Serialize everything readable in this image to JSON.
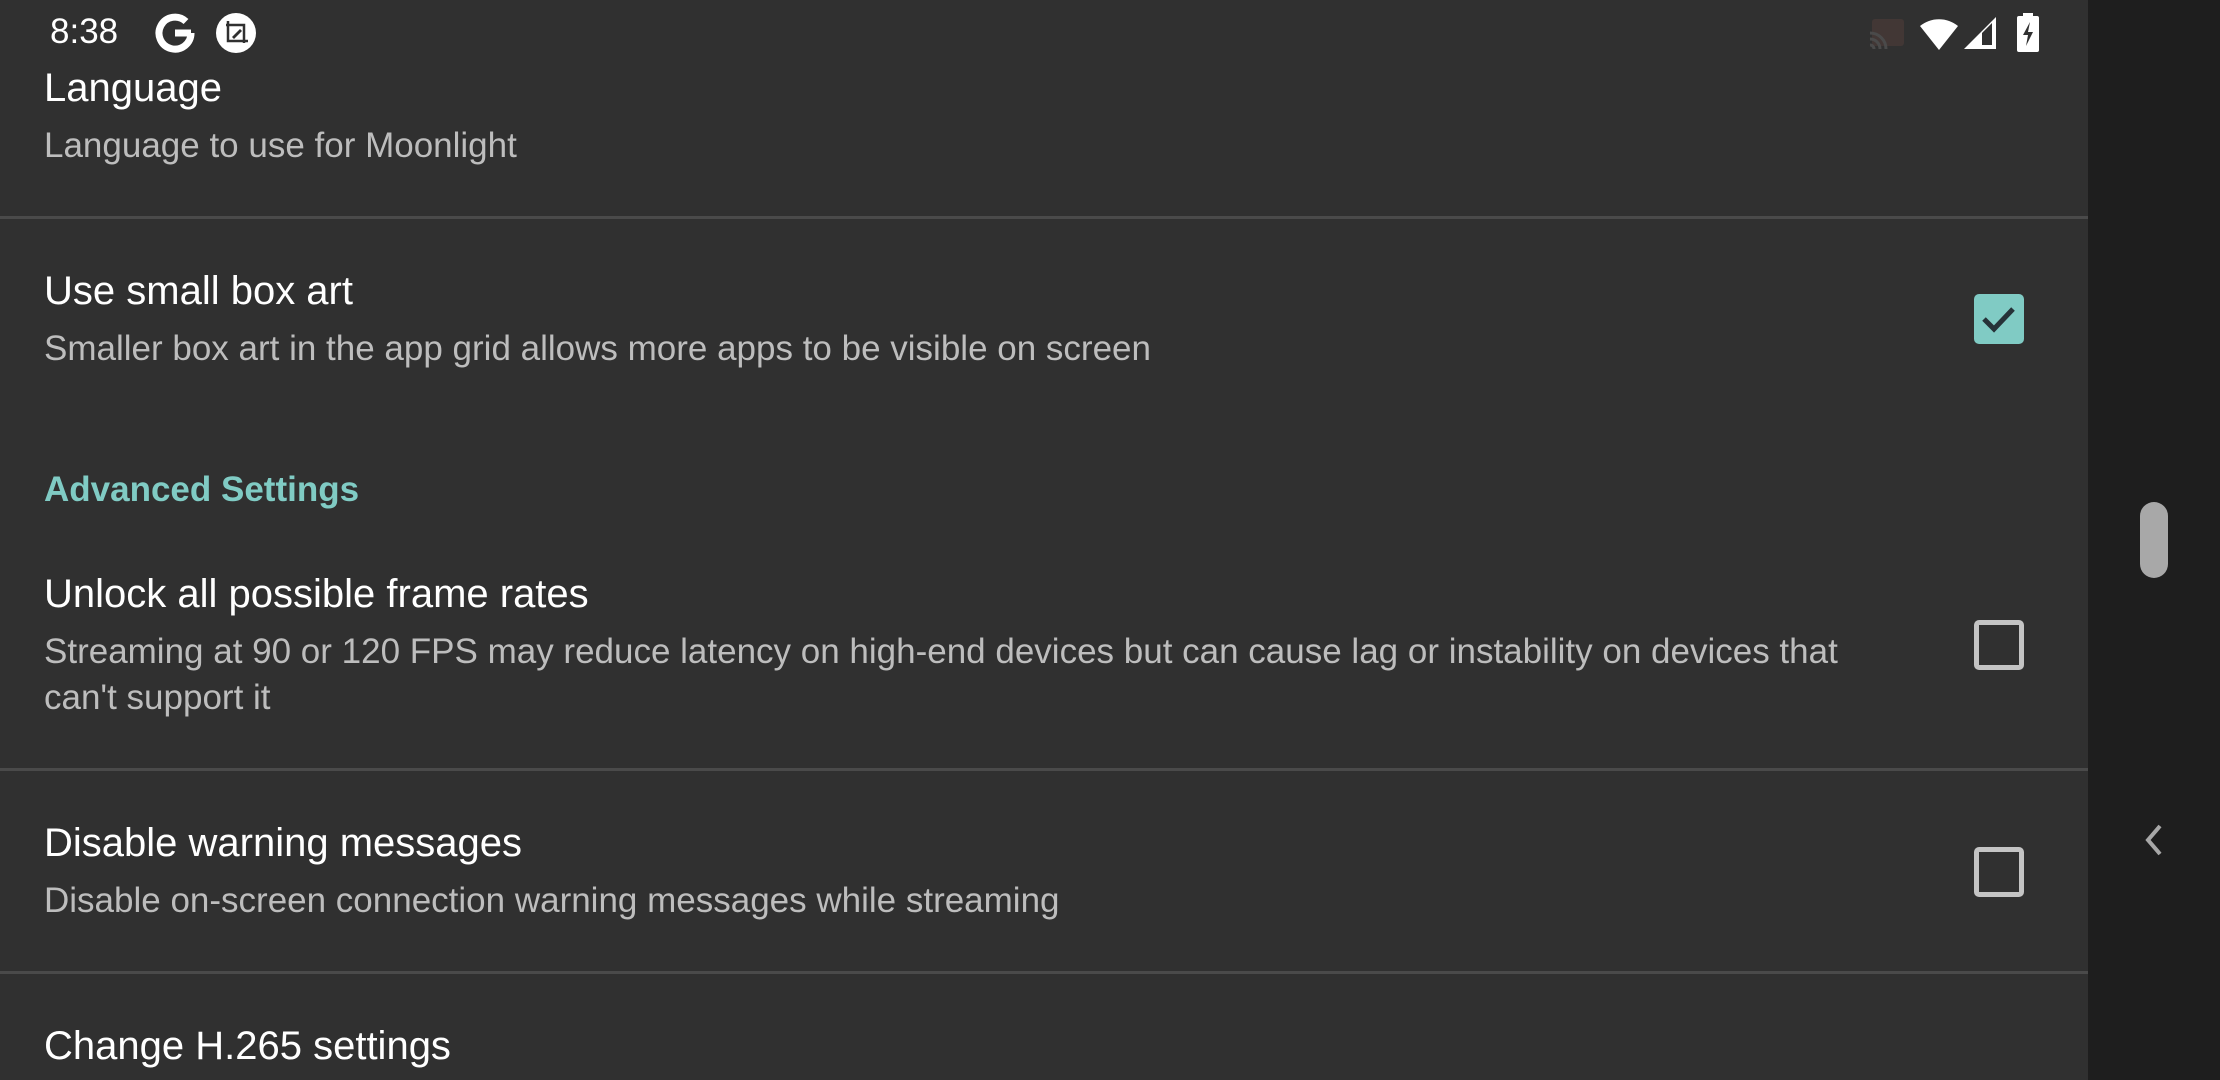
{
  "status_bar": {
    "time": "8:38",
    "left_icons": [
      "google-icon",
      "screenshot-edit-icon"
    ],
    "right_icons": [
      "cast-icon",
      "wifi-icon",
      "cellular-signal-icon",
      "battery-charging-icon"
    ]
  },
  "preferences": [
    {
      "id": "language",
      "title": "Language",
      "summary": "Language to use for Moonlight"
    },
    {
      "id": "small-box-art",
      "title": "Use small box art",
      "summary": "Smaller box art in the app grid allows more apps to be visible on screen",
      "checked": true
    }
  ],
  "category": {
    "title": "Advanced Settings"
  },
  "advanced_preferences": [
    {
      "id": "unlock-frame-rates",
      "title": "Unlock all possible frame rates",
      "summary": "Streaming at 90 or 120 FPS may reduce latency on high-end devices but can cause lag or instability on devices that can't support it",
      "checked": false
    },
    {
      "id": "disable-warnings",
      "title": "Disable warning messages",
      "summary": "Disable on-screen connection warning messages while streaming",
      "checked": false
    },
    {
      "id": "h265-settings",
      "title": "Change H.265 settings"
    }
  ],
  "colors": {
    "background": "#303030",
    "accent": "#80cbc4",
    "divider": "#4a4a4a",
    "side_panel": "#1e1e1e"
  }
}
